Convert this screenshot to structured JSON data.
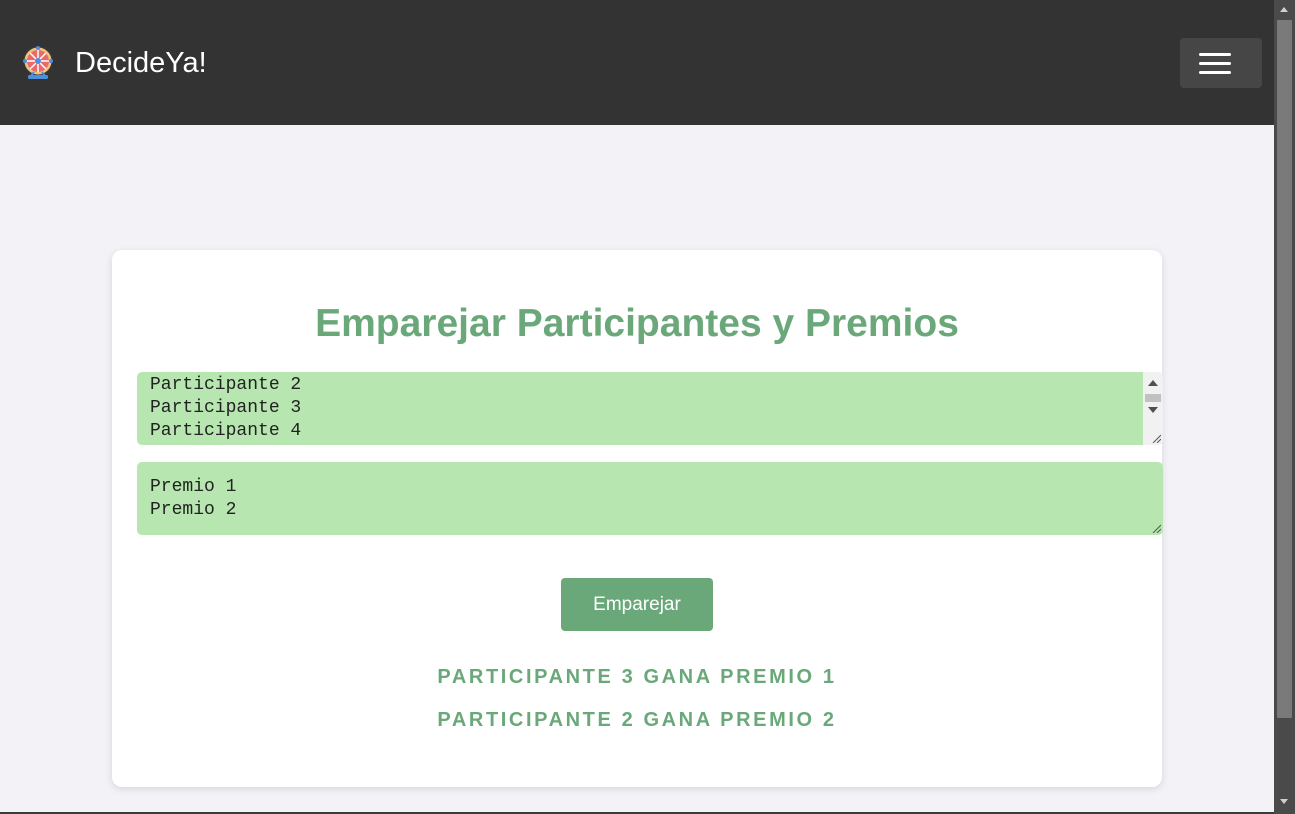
{
  "navbar": {
    "brand": "DecideYa!",
    "logo_icon": "ferris-wheel-icon",
    "menu_icon": "hamburger-menu-icon",
    "background": "#333333"
  },
  "main": {
    "title": "Emparejar Participantes y Premios",
    "participants_lines": [
      "Participante 2",
      "Participante 3",
      "Participante 4"
    ],
    "prizes_lines": [
      "Premio 1",
      "Premio 2"
    ],
    "pair_button_label": "Emparejar",
    "results": [
      "PARTICIPANTE 3 GANA PREMIO 1",
      "PARTICIPANTE 2 GANA PREMIO 2"
    ]
  },
  "colors": {
    "accent": "#6aa87a",
    "textarea_bg": "#b7e6b0",
    "page_bg": "#f3f3f7"
  }
}
